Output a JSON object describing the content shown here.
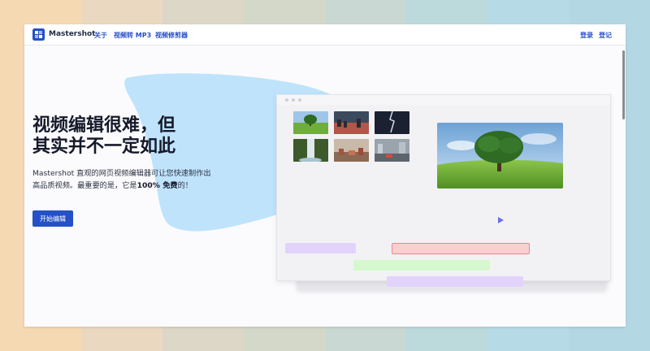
{
  "nav": {
    "brand": "Mastershot",
    "links": [
      "关于",
      "视频转 MP3",
      "视频修剪器"
    ],
    "login": "登录",
    "register": "登记"
  },
  "hero": {
    "title_line1": "视频编辑很难，但",
    "title_line2": "其实并不一定如此",
    "desc_part1": "Mastershot 直观的网页视频编辑器可让您快速制作出高品质视频。最重要的是，它是",
    "desc_bold": "100% 免费",
    "desc_part2": "的！",
    "cta_label": "开始编辑"
  },
  "editor_mockup": {
    "media_thumbnails": [
      "tree-meadow",
      "sunset-city",
      "lightning-storm",
      "waterfall",
      "city-aerial",
      "traffic-street"
    ],
    "preview": "tree-meadow",
    "timeline_clips": [
      "purple-clip",
      "red-clip",
      "green-clip",
      "purple-clip-2"
    ]
  },
  "colors": {
    "accent": "#2451c8",
    "nav_link": "#2a51c7",
    "blob": "#bfe3fb",
    "play_icon": "#6a6fe3",
    "clip_purple": "#e2d3fb",
    "clip_red": "#fbcfcf",
    "clip_red_border": "#e48b8b",
    "clip_green": "#d6f8cf",
    "background_stripes": [
      "#f5d9b3",
      "#ead9c0",
      "#dcd7c6",
      "#d4d8c9",
      "#c9d8d2",
      "#bcd9dc",
      "#b6dbe6",
      "#b3d8e3"
    ]
  }
}
